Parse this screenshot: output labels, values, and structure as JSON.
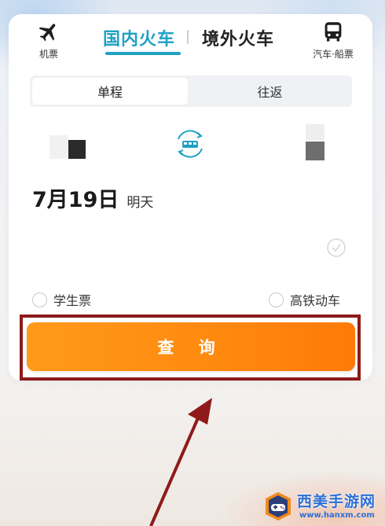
{
  "tabs": {
    "flight_label": "机票",
    "domestic_label": "国内火车",
    "overseas_label": "境外火车",
    "bus_ship_label": "汽车·船票"
  },
  "trip_type": {
    "one_way_label": "单程",
    "round_trip_label": "往返",
    "selected": "单程"
  },
  "date": {
    "main": "7月19日",
    "relative": "明天"
  },
  "options": {
    "student_label": "学生票",
    "high_speed_label": "高铁动车"
  },
  "query_button_label": "查 询",
  "watermark": {
    "title": "西美手游网",
    "url": "www.hanxm.com"
  },
  "colors": {
    "accent_teal": "#1fa1c4",
    "query_orange": "#ff8a10",
    "highlight_red": "#8e1a1a",
    "arrow_red": "#8e1a1a"
  }
}
